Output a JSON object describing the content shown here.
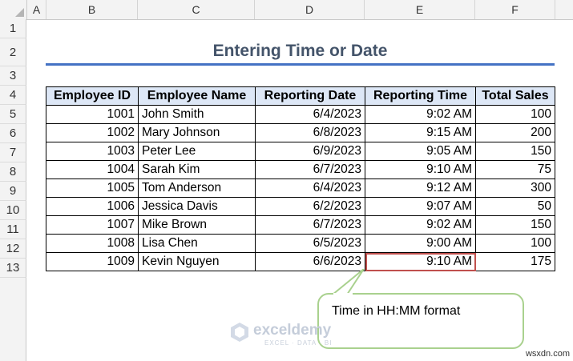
{
  "sheet": {
    "columns": [
      "A",
      "B",
      "C",
      "D",
      "E",
      "F"
    ],
    "rows": [
      "1",
      "2",
      "3",
      "4",
      "5",
      "6",
      "7",
      "8",
      "9",
      "10",
      "11",
      "12",
      "13"
    ]
  },
  "title": "Entering Time or Date",
  "table": {
    "headers": [
      "Employee ID",
      "Employee Name",
      "Reporting Date",
      "Reporting Time",
      "Total Sales"
    ],
    "rows": [
      [
        "1001",
        "John Smith",
        "6/4/2023",
        "9:02 AM",
        "100"
      ],
      [
        "1002",
        "Mary Johnson",
        "6/8/2023",
        "9:15 AM",
        "200"
      ],
      [
        "1003",
        "Peter Lee",
        "6/9/2023",
        "9:05 AM",
        "150"
      ],
      [
        "1004",
        "Sarah Kim",
        "6/7/2023",
        "9:10 AM",
        "75"
      ],
      [
        "1005",
        "Tom Anderson",
        "6/4/2023",
        "9:12 AM",
        "300"
      ],
      [
        "1006",
        "Jessica Davis",
        "6/2/2023",
        "9:07 AM",
        "50"
      ],
      [
        "1007",
        "Mike Brown",
        "6/7/2023",
        "9:02 AM",
        "150"
      ],
      [
        "1008",
        "Lisa Chen",
        "6/5/2023",
        "9:00 AM",
        "100"
      ],
      [
        "1009",
        "Kevin Nguyen",
        "6/6/2023",
        "9:10 AM",
        "175"
      ]
    ]
  },
  "callout": {
    "text": "Time in HH:MM format"
  },
  "watermark": {
    "brand": "exceldemy",
    "tagline": "EXCEL · DATA · BI"
  },
  "site_tag": "wsxdn.com",
  "colors": {
    "title": "#44546a",
    "rule": "#4472c4",
    "header_fill": "#dde7f6",
    "highlight": "#c0504d",
    "callout_border": "#a9d18e"
  }
}
